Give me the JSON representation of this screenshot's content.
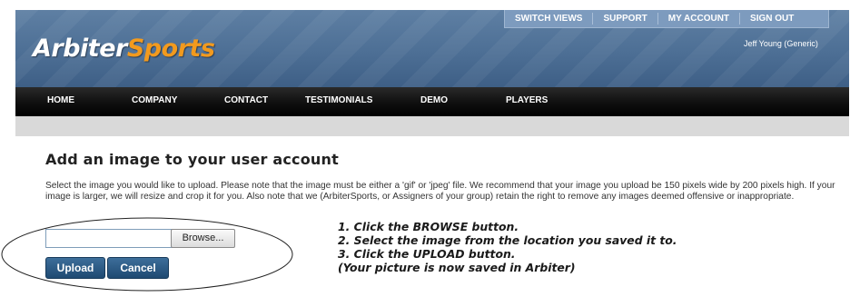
{
  "header": {
    "logo_part1": "Arbiter",
    "logo_part2": "Sports",
    "top_links": [
      "SWITCH VIEWS",
      "SUPPORT",
      "MY ACCOUNT",
      "SIGN OUT"
    ],
    "user_name": "Jeff Young (Generic)"
  },
  "main_nav": [
    "HOME",
    "COMPANY",
    "CONTACT",
    "TESTIMONIALS",
    "DEMO",
    "PLAYERS"
  ],
  "page": {
    "title": "Add an image to your user account",
    "description": "Select the image you would like to upload. Please note that the image must be either a 'gif' or 'jpeg' file. We recommend that your image you upload be 150 pixels wide by 200 pixels high. If your image is larger, we will resize and crop it for you. Also note that we (ArbiterSports, or Assigners of your group) retain the right to remove any images deemed offensive or inappropriate.",
    "file_value": "",
    "browse_label": "Browse...",
    "upload_label": "Upload",
    "cancel_label": "Cancel"
  },
  "instructions": [
    "1. Click the BROWSE button.",
    "2. Select the image from the location you saved it to.",
    "3. Click the UPLOAD button.",
    "(Your picture is now saved in Arbiter)"
  ],
  "colors": {
    "header_blue": "#4d6f95",
    "logo_orange": "#f29a1e",
    "button_blue": "#2a5a86"
  }
}
